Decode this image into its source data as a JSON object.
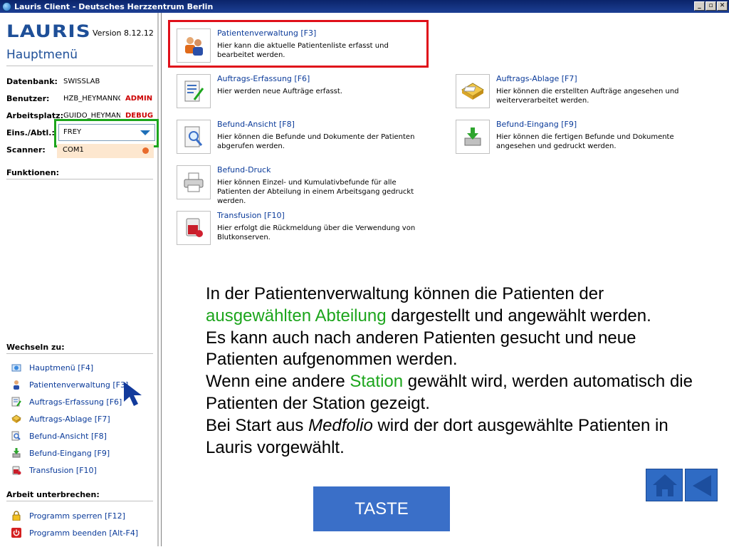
{
  "window": {
    "title": "Lauris Client - Deutsches Herzzentrum Berlin"
  },
  "sidebar": {
    "logo": "LAURIS",
    "version": "Version 8.12.12",
    "title": "Hauptmenü",
    "info": {
      "db_label": "Datenbank:",
      "db_value": "SWISSLAB",
      "user_label": "Benutzer:",
      "user_value": "HZB_HEYMANNG",
      "user_tag": "ADMIN",
      "ws_label": "Arbeitsplatz:",
      "ws_value": "GUIDO_HEYMAN",
      "ws_tag": "DEBUG",
      "dept_label": "Eins./Abtl.:",
      "dept_value": "FREY",
      "scanner_label": "Scanner:",
      "scanner_value": "COM1"
    },
    "functions_title": "Funktionen:",
    "switch_title": "Wechseln zu:",
    "switch_items": [
      {
        "label": "Hauptmenü [F4]"
      },
      {
        "label": "Patientenverwaltung [F3]"
      },
      {
        "label": "Auftrags-Erfassung [F6]"
      },
      {
        "label": "Auftrags-Ablage [F7]"
      },
      {
        "label": "Befund-Ansicht [F8]"
      },
      {
        "label": "Befund-Eingang [F9]"
      },
      {
        "label": "Transfusion [F10]"
      }
    ],
    "pause_title": "Arbeit unterbrechen:",
    "pause_items": [
      {
        "label": "Programm sperren [F12]"
      },
      {
        "label": "Programm beenden [Alt-F4]"
      }
    ]
  },
  "main": {
    "tiles": [
      {
        "title": "Patientenverwaltung [F3]",
        "desc": "Hier kann die aktuelle Patientenliste erfasst und bearbeitet werden."
      },
      {
        "title": "Auftrags-Erfassung [F6]",
        "desc": "Hier werden neue Aufträge erfasst."
      },
      {
        "title": "Auftrags-Ablage [F7]",
        "desc": "Hier können die erstellten Aufträge angesehen und weiterverarbeitet werden."
      },
      {
        "title": "Befund-Ansicht [F8]",
        "desc": "Hier können die Befunde und Dokumente der Patienten abgerufen werden."
      },
      {
        "title": "Befund-Eingang [F9]",
        "desc": "Hier können die fertigen Befunde und Dokumente angesehen und gedruckt werden."
      },
      {
        "title": "Befund-Druck",
        "desc": "Hier können Einzel- und Kumulativbefunde für alle Patienten der Abteilung in einem Arbeitsgang gedruckt werden."
      },
      {
        "title": "Transfusion [F10]",
        "desc": "Hier erfolgt die Rückmeldung über die Verwendung von Blutkonserven."
      }
    ],
    "explain": {
      "p1": "In der Patientenverwaltung können die Patienten der ",
      "p1_green": "ausgewählten Abteilung",
      "p1_end": " dargestellt und angewählt werden.",
      "p2": "Es kann auch nach anderen Patienten gesucht und neue Patienten aufgenommen werden.",
      "p3": "Wenn eine andere ",
      "p3_green": "Station",
      "p3_end": " gewählt wird, werden automatisch die Patienten der Station gezeigt.",
      "p4": "Bei Start aus ",
      "p4_italic": "Medfolio",
      "p4_end": " wird der dort ausgewählte Patienten in Lauris vorgewählt."
    },
    "taste_label": "TASTE"
  }
}
